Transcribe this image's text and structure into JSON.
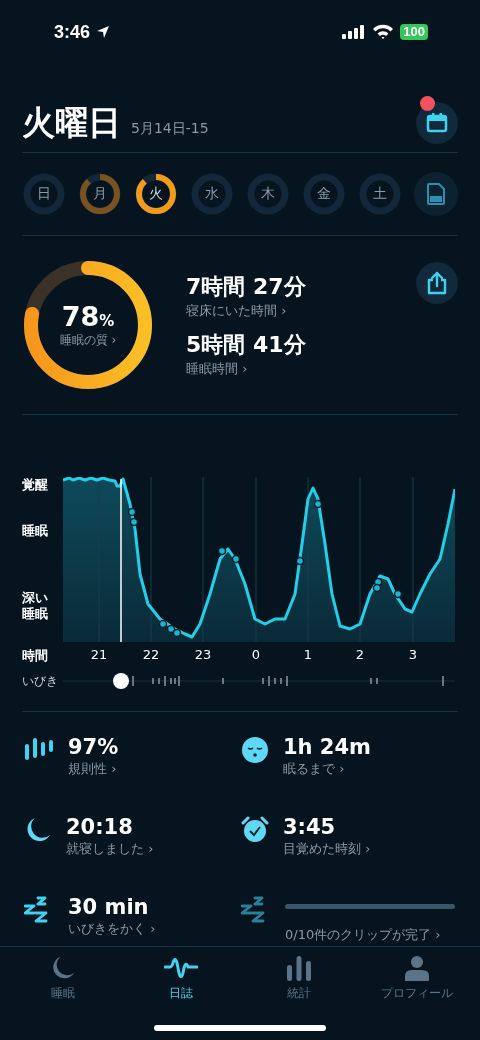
{
  "status_bar": {
    "time": "3:46",
    "battery": "100"
  },
  "header": {
    "title": "火曜日",
    "date": "5月14日-15",
    "notification": true
  },
  "days": [
    {
      "label": "日",
      "scored": false,
      "selected": false
    },
    {
      "label": "月",
      "scored": true,
      "selected": false
    },
    {
      "label": "火",
      "scored": true,
      "selected": true
    },
    {
      "label": "水",
      "scored": false,
      "selected": false
    },
    {
      "label": "木",
      "scored": false,
      "selected": false
    },
    {
      "label": "金",
      "scored": false,
      "selected": false
    },
    {
      "label": "土",
      "scored": false,
      "selected": false
    }
  ],
  "quality": {
    "value": "78",
    "unit": "%",
    "label": "睡眠の質 ›",
    "level": 0.78
  },
  "durations": [
    {
      "value": "7時間 27分",
      "label": "寝床にいた時間 ›"
    },
    {
      "value": "5時間 41分",
      "label": "睡眠時間 ›"
    }
  ],
  "hypnogram": {
    "stages": [
      "覚醒",
      "睡眠",
      "深い睡眠"
    ],
    "axis_label": "時間",
    "hours": [
      "21",
      "22",
      "23",
      "0",
      "1",
      "2",
      "3"
    ],
    "snore_label": "いびき"
  },
  "stats": [
    {
      "kind": "bars",
      "value": "97%",
      "label": "規則性 ›"
    },
    {
      "kind": "face",
      "value": "1h 24m",
      "label": "眠るまで ›"
    },
    {
      "kind": "moon",
      "value": "20:18",
      "label": "就寝しました ›"
    },
    {
      "kind": "alarm",
      "value": "3:45",
      "label": "目覚めた時刻 ›"
    },
    {
      "kind": "zzz",
      "value": "30 min",
      "label": "いびきをかく ›"
    },
    {
      "kind": "progress",
      "label": "0/10件のクリップが完了 ›"
    }
  ],
  "tabs": [
    {
      "kind": "moon",
      "label": "睡眠",
      "selected": false
    },
    {
      "kind": "wave",
      "label": "日誌",
      "selected": true
    },
    {
      "kind": "bars",
      "label": "統計",
      "selected": false
    },
    {
      "kind": "person",
      "label": "プロフィール",
      "selected": false
    }
  ]
}
